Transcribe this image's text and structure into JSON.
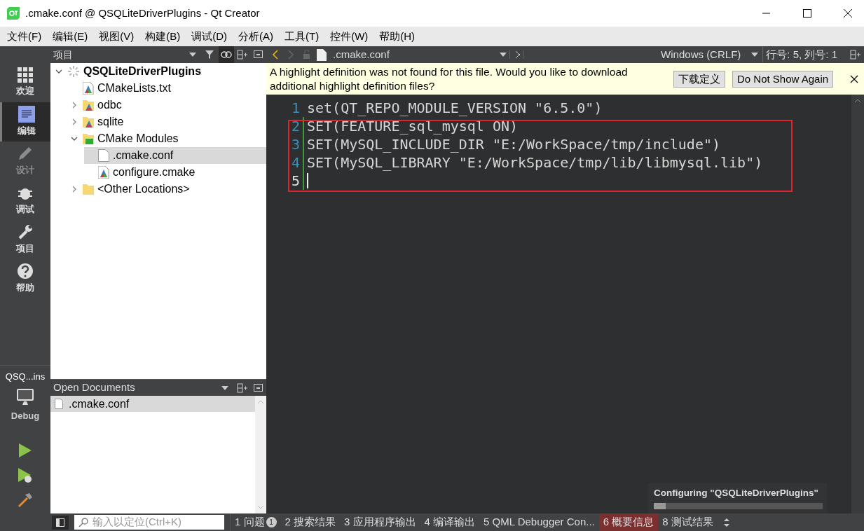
{
  "window": {
    "title": ".cmake.conf @ QSQLiteDriverPlugins - Qt Creator"
  },
  "menu": [
    "文件(F)",
    "编辑(E)",
    "视图(V)",
    "构建(B)",
    "调试(D)",
    "分析(A)",
    "工具(T)",
    "控件(W)",
    "帮助(H)"
  ],
  "modes": [
    {
      "kind": "grid",
      "label": "欢迎",
      "selected": false,
      "disabled": false
    },
    {
      "kind": "edit",
      "label": "编辑",
      "selected": true,
      "disabled": false
    },
    {
      "kind": "pencil",
      "label": "设计",
      "selected": false,
      "disabled": true
    },
    {
      "kind": "bug",
      "label": "调试",
      "selected": false,
      "disabled": false
    },
    {
      "kind": "wrench",
      "label": "项目",
      "selected": false,
      "disabled": false
    },
    {
      "kind": "help",
      "label": "帮助",
      "selected": false,
      "disabled": false
    }
  ],
  "kit": {
    "project": "QSQ...ins",
    "build": "Debug"
  },
  "project_panel": {
    "title": "项目",
    "tree": [
      {
        "kind": "root",
        "label": "QSQLiteDriverPlugins",
        "expanded": true,
        "selected": false,
        "children": [
          {
            "kind": "cmake",
            "label": "CMakeLists.txt",
            "selected": false
          },
          {
            "kind": "cmake-folder",
            "label": "odbc",
            "expanded": false,
            "selected": false
          },
          {
            "kind": "cmake-folder",
            "label": "sqlite",
            "expanded": false,
            "selected": false
          },
          {
            "kind": "modules",
            "label": "CMake Modules",
            "expanded": true,
            "selected": false,
            "children": [
              {
                "kind": "file",
                "label": ".cmake.conf",
                "selected": true
              },
              {
                "kind": "cmake",
                "label": "configure.cmake",
                "selected": false
              }
            ]
          },
          {
            "kind": "folder",
            "label": "<Other Locations>",
            "expanded": false,
            "selected": false
          }
        ]
      }
    ]
  },
  "open_documents": {
    "title": "Open Documents",
    "items": [
      {
        "label": ".cmake.conf",
        "selected": true
      }
    ]
  },
  "editor": {
    "file": ".cmake.conf",
    "line_ending": "Windows (CRLF)",
    "position": "行号: 5, 列号: 1",
    "infobar": {
      "message": "A highlight definition was not found for this file. Would you like to download additional highlight definition files?",
      "buttons": [
        "下载定义",
        "Do Not Show Again"
      ]
    },
    "lines": [
      {
        "number": "1",
        "text": "set(QT_REPO_MODULE_VERSION \"6.5.0\")",
        "modified": false
      },
      {
        "number": "2",
        "text": "SET(FEATURE_sql_mysql ON)",
        "modified": true
      },
      {
        "number": "3",
        "text": "SET(MySQL_INCLUDE_DIR \"E:/WorkSpace/tmp/include\")",
        "modified": true
      },
      {
        "number": "4",
        "text": "SET(MySQL_LIBRARY \"E:/WorkSpace/tmp/lib/libmysql.lib\")",
        "modified": true
      },
      {
        "number": "5",
        "modified": true,
        "current": true
      }
    ]
  },
  "progress": {
    "title": "Configuring \"QSQLiteDriverPlugins\"",
    "level": 0.07
  },
  "status_bar": {
    "locator_placeholder": "输入以定位(Ctrl+K)",
    "panes": [
      {
        "label": "1 问题",
        "badge": "1",
        "selected": false
      },
      {
        "label": "2 搜索结果",
        "selected": false
      },
      {
        "label": "3 应用程序输出",
        "selected": false
      },
      {
        "label": "4 编译输出",
        "selected": false
      },
      {
        "label": "5 QML Debugger Con...",
        "selected": false
      },
      {
        "label": "6 概要信息",
        "selected": true
      },
      {
        "label": "8 测试结果",
        "selected": false
      }
    ]
  }
}
